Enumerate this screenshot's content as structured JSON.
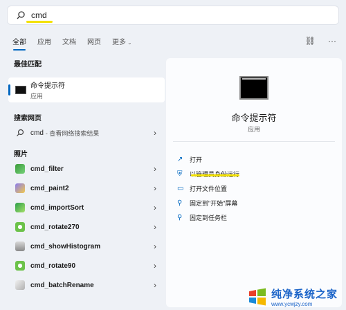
{
  "search": {
    "value": "cmd",
    "placeholder": ""
  },
  "tabs": [
    {
      "label": "全部"
    },
    {
      "label": "应用"
    },
    {
      "label": "文档"
    },
    {
      "label": "网页"
    },
    {
      "label": "更多"
    }
  ],
  "sections": {
    "best_match": "最佳匹配",
    "web_search": "搜索网页",
    "photos": "照片"
  },
  "best_match": {
    "title": "命令提示符",
    "subtitle": "应用"
  },
  "web_item": {
    "query": "cmd",
    "suffix": "- 查看网络搜索结果"
  },
  "photo_items": [
    {
      "name": "cmd_filter"
    },
    {
      "name": "cmd_paint2"
    },
    {
      "name": "cmd_importSort"
    },
    {
      "name": "cmd_rotate270"
    },
    {
      "name": "cmd_showHistogram"
    },
    {
      "name": "cmd_rotate90"
    },
    {
      "name": "cmd_batchRename"
    }
  ],
  "detail": {
    "app_name": "命令提示符",
    "app_type": "应用",
    "actions": [
      {
        "label": "打开",
        "icon": "open-icon"
      },
      {
        "label": "以管理员身份运行",
        "icon": "shield-icon"
      },
      {
        "label": "打开文件位置",
        "icon": "folder-icon"
      },
      {
        "label": "固定到\"开始\"屏幕",
        "icon": "pin-icon"
      },
      {
        "label": "固定到任务栏",
        "icon": "pin-icon"
      }
    ]
  },
  "watermark": {
    "title": "纯净系统之家",
    "url": "www.ycwjzy.com"
  },
  "colors": {
    "accent": "#0067c0",
    "highlight": "#f3e100"
  }
}
